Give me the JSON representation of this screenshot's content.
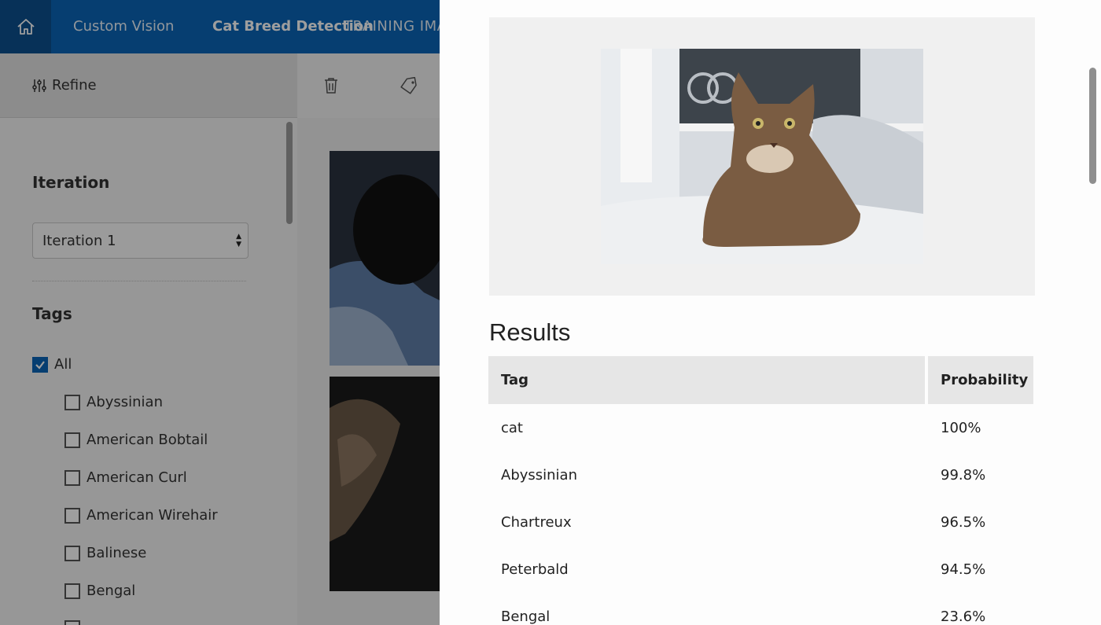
{
  "header": {
    "brand": "Custom Vision",
    "project": "Cat Breed Detection",
    "breadcrumb": "TRAINING IMA"
  },
  "toolbar": {
    "refine_label": "Refine"
  },
  "sidebar": {
    "iteration_heading": "Iteration",
    "iteration_selected": "Iteration 1",
    "tags_heading": "Tags",
    "all_label": "All",
    "tags": [
      "Abyssinian",
      "American Bobtail",
      "American Curl",
      "American Wirehair",
      "Balinese",
      "Bengal"
    ]
  },
  "panel": {
    "results_title": "Results",
    "table": {
      "columns": [
        "Tag",
        "Probability"
      ],
      "rows": [
        {
          "tag": "cat",
          "probability": "100%"
        },
        {
          "tag": "Abyssinian",
          "probability": "99.8%"
        },
        {
          "tag": "Chartreux",
          "probability": "96.5%"
        },
        {
          "tag": "Peterbald",
          "probability": "94.5%"
        },
        {
          "tag": "Bengal",
          "probability": "23.6%"
        }
      ]
    }
  },
  "colors": {
    "topbar": "#0a65b6",
    "home": "#0c4f8e",
    "checkbox_checked": "#0a65b6"
  }
}
